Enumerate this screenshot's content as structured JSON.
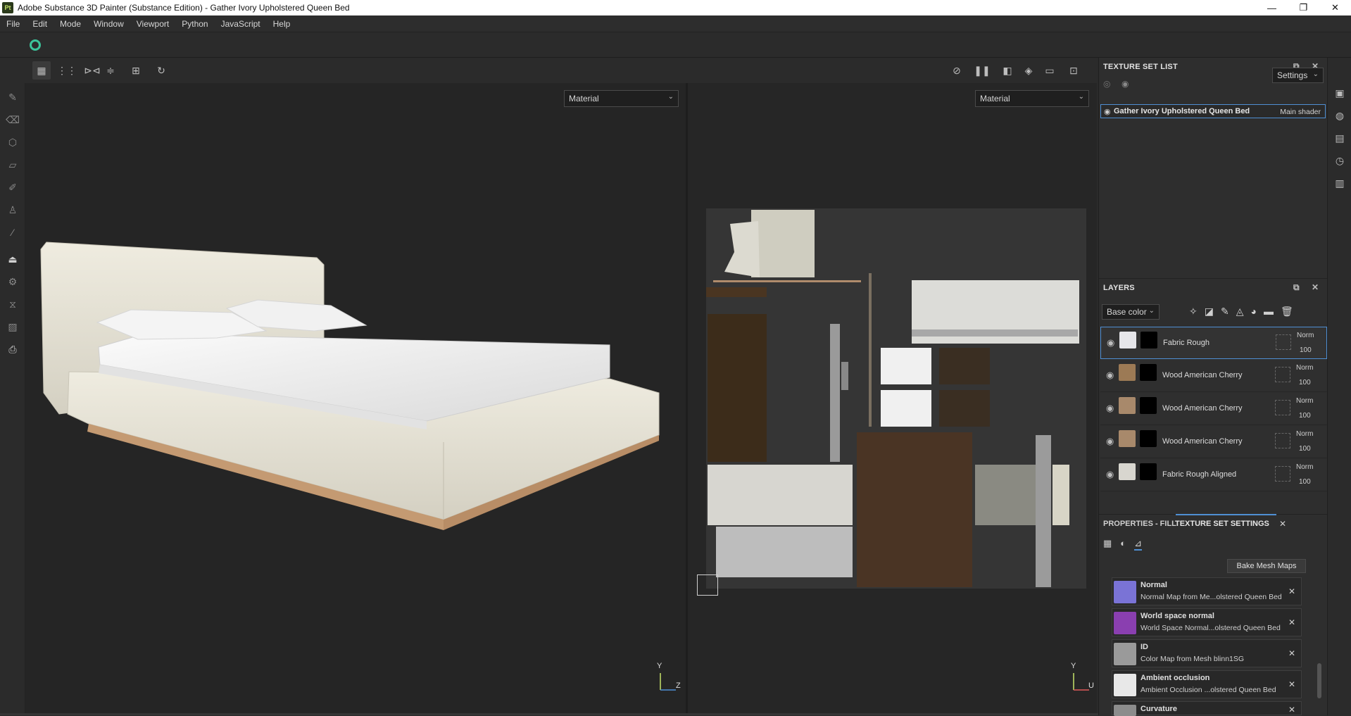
{
  "window": {
    "app_icon": "Pt",
    "title": "Adobe Substance 3D Painter (Substance Edition) - Gather Ivory Upholstered Queen Bed",
    "controls": {
      "minimize": "—",
      "maximize": "❐",
      "close": "✕"
    }
  },
  "menu": [
    "File",
    "Edit",
    "Mode",
    "Window",
    "Viewport",
    "Python",
    "JavaScript",
    "Help"
  ],
  "viewport_3d": {
    "channel_dropdown": "Material",
    "axis_y": "Y",
    "axis_z": "Z"
  },
  "viewport_2d": {
    "channel_dropdown": "Material",
    "axis_y": "Y",
    "axis_u": "U"
  },
  "texture_set_list": {
    "header": "TEXTURE SET LIST",
    "settings_dropdown": "Settings",
    "item": {
      "name": "Gather Ivory Upholstered Queen Bed",
      "shader": "Main shader"
    }
  },
  "layers": {
    "header": "LAYERS",
    "channel_dropdown": "Base color",
    "rows": [
      {
        "name": "Fabric Rough",
        "blend": "Norm",
        "opacity": "100",
        "thumb_color": "#e6e6ea",
        "selected": true
      },
      {
        "name": "Wood American Cherry",
        "blend": "Norm",
        "opacity": "100",
        "thumb_color": "#9c7a55",
        "selected": false
      },
      {
        "name": "Wood American Cherry",
        "blend": "Norm",
        "opacity": "100",
        "thumb_color": "#a8896b",
        "selected": false
      },
      {
        "name": "Wood American Cherry",
        "blend": "Norm",
        "opacity": "100",
        "thumb_color": "#a8896b",
        "selected": false
      },
      {
        "name": "Fabric Rough Aligned",
        "blend": "Norm",
        "opacity": "100",
        "thumb_color": "#d8d6cf",
        "selected": false
      }
    ]
  },
  "properties": {
    "tab_properties": "PROPERTIES - FILL",
    "tab_texture_set": "TEXTURE SET SETTINGS",
    "bake_button": "Bake Mesh Maps",
    "mesh_maps": [
      {
        "title": "Normal",
        "subtitle": "Normal Map from Me...olstered Queen Bed",
        "color": "#7a73d6"
      },
      {
        "title": "World space normal",
        "subtitle": "World Space Normal...olstered Queen Bed",
        "color": "#8a3fb0"
      },
      {
        "title": "ID",
        "subtitle": "Color Map from Mesh blinn1SG",
        "color": "#9a9a9a"
      },
      {
        "title": "Ambient occlusion",
        "subtitle": "Ambient Occlusion ...olstered Queen Bed",
        "color": "#e8e8e8"
      },
      {
        "title": "Curvature",
        "subtitle": "",
        "color": "#8c8c8c"
      }
    ]
  },
  "colors": {
    "accent": "#4f8fd4",
    "viewport_bg": "#252525",
    "panel_bg": "#2e2e2e"
  }
}
